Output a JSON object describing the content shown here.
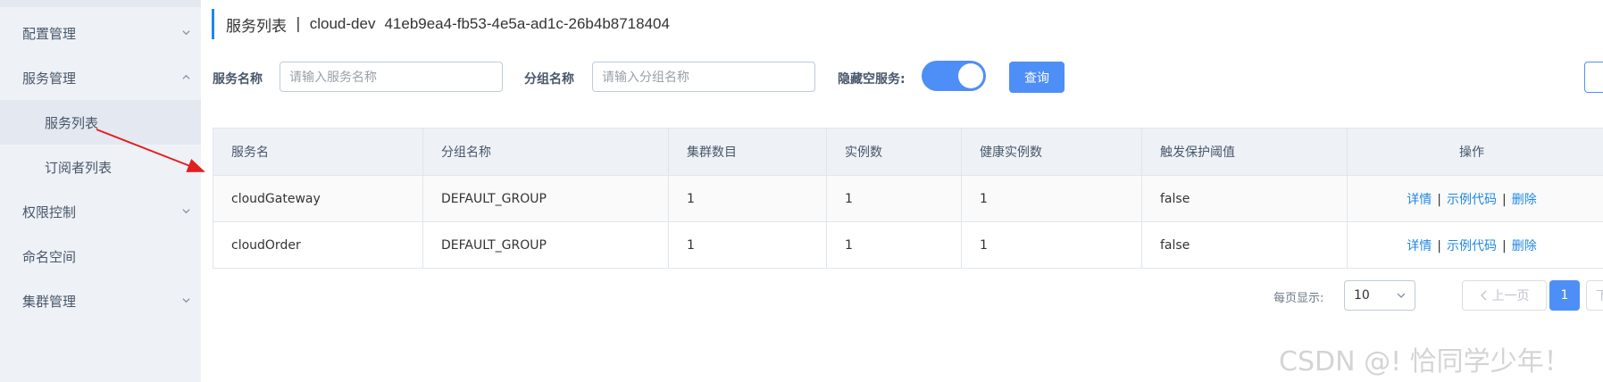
{
  "sidebar": {
    "items": [
      {
        "label": "配置管理"
      },
      {
        "label": "服务管理"
      },
      {
        "label": "服务列表"
      },
      {
        "label": "订阅者列表"
      },
      {
        "label": "权限控制"
      },
      {
        "label": "命名空间"
      },
      {
        "label": "集群管理"
      }
    ]
  },
  "header": {
    "title": "服务列表",
    "separator": "|",
    "namespace": "cloud-dev",
    "namespace_id": "41eb9ea4-fb53-4e5a-ad1c-26b4b8718404"
  },
  "search": {
    "service_name_label": "服务名称",
    "service_name_placeholder": "请输入服务名称",
    "group_name_label": "分组名称",
    "group_name_placeholder": "请输入分组名称",
    "hide_empty_label": "隐藏空服务:",
    "hide_empty_on": true,
    "query_label": "查询"
  },
  "table": {
    "columns": [
      "服务名",
      "分组名称",
      "集群数目",
      "实例数",
      "健康实例数",
      "触发保护阈值",
      "操作"
    ],
    "rows": [
      {
        "service": "cloudGateway",
        "group": "DEFAULT_GROUP",
        "clusters": "1",
        "instances": "1",
        "healthy": "1",
        "threshold": "false"
      },
      {
        "service": "cloudOrder",
        "group": "DEFAULT_GROUP",
        "clusters": "1",
        "instances": "1",
        "healthy": "1",
        "threshold": "false"
      }
    ],
    "ops": {
      "detail": "详情",
      "sample": "示例代码",
      "delete": "删除",
      "sep": "|"
    }
  },
  "pagination": {
    "page_size_label": "每页显示:",
    "page_size": "10",
    "prev_label": "上一页",
    "current_page": "1",
    "next_label": "下"
  },
  "watermark": "CSDN @! 恰同学少年！",
  "colors": {
    "accent": "#4e8ef7",
    "link": "#1e88e5",
    "arrow": "#e02020"
  }
}
